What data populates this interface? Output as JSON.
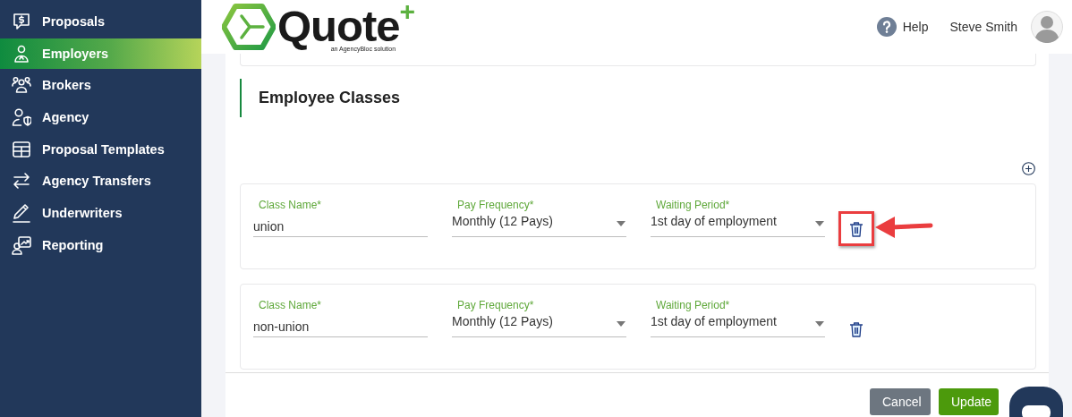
{
  "logo": {
    "name": "Quote",
    "mark": "+",
    "tagline": "an AgencyBloc solution"
  },
  "sidebar": {
    "items": [
      {
        "label": "Proposals",
        "selected": false
      },
      {
        "label": "Employers",
        "selected": true
      },
      {
        "label": "Brokers",
        "selected": false
      },
      {
        "label": "Agency",
        "selected": false
      },
      {
        "label": "Proposal Templates",
        "selected": false
      },
      {
        "label": "Agency Transfers",
        "selected": false
      },
      {
        "label": "Underwriters",
        "selected": false
      },
      {
        "label": "Reporting",
        "selected": false
      }
    ]
  },
  "header": {
    "help": "Help",
    "user": "Steve Smith"
  },
  "section": {
    "title": "Employee Classes"
  },
  "classes": [
    {
      "highlighted": true,
      "fields": [
        {
          "kind": "text",
          "label": "Class Name*",
          "value": "union"
        },
        {
          "kind": "select",
          "label": "Pay Frequency*",
          "value": "Monthly (12 Pays)"
        },
        {
          "kind": "select",
          "label": "Waiting Period*",
          "value": "1st day of employment"
        }
      ]
    },
    {
      "highlighted": false,
      "fields": [
        {
          "kind": "text",
          "label": "Class Name*",
          "value": "non-union"
        },
        {
          "kind": "select",
          "label": "Pay Frequency*",
          "value": "Monthly (12 Pays)"
        },
        {
          "kind": "select",
          "label": "Waiting Period*",
          "value": "1st day of employment"
        }
      ]
    }
  ],
  "buttons": [
    {
      "label": "Cancel",
      "kind": "secondary"
    },
    {
      "label": "Update",
      "kind": "primary"
    }
  ]
}
